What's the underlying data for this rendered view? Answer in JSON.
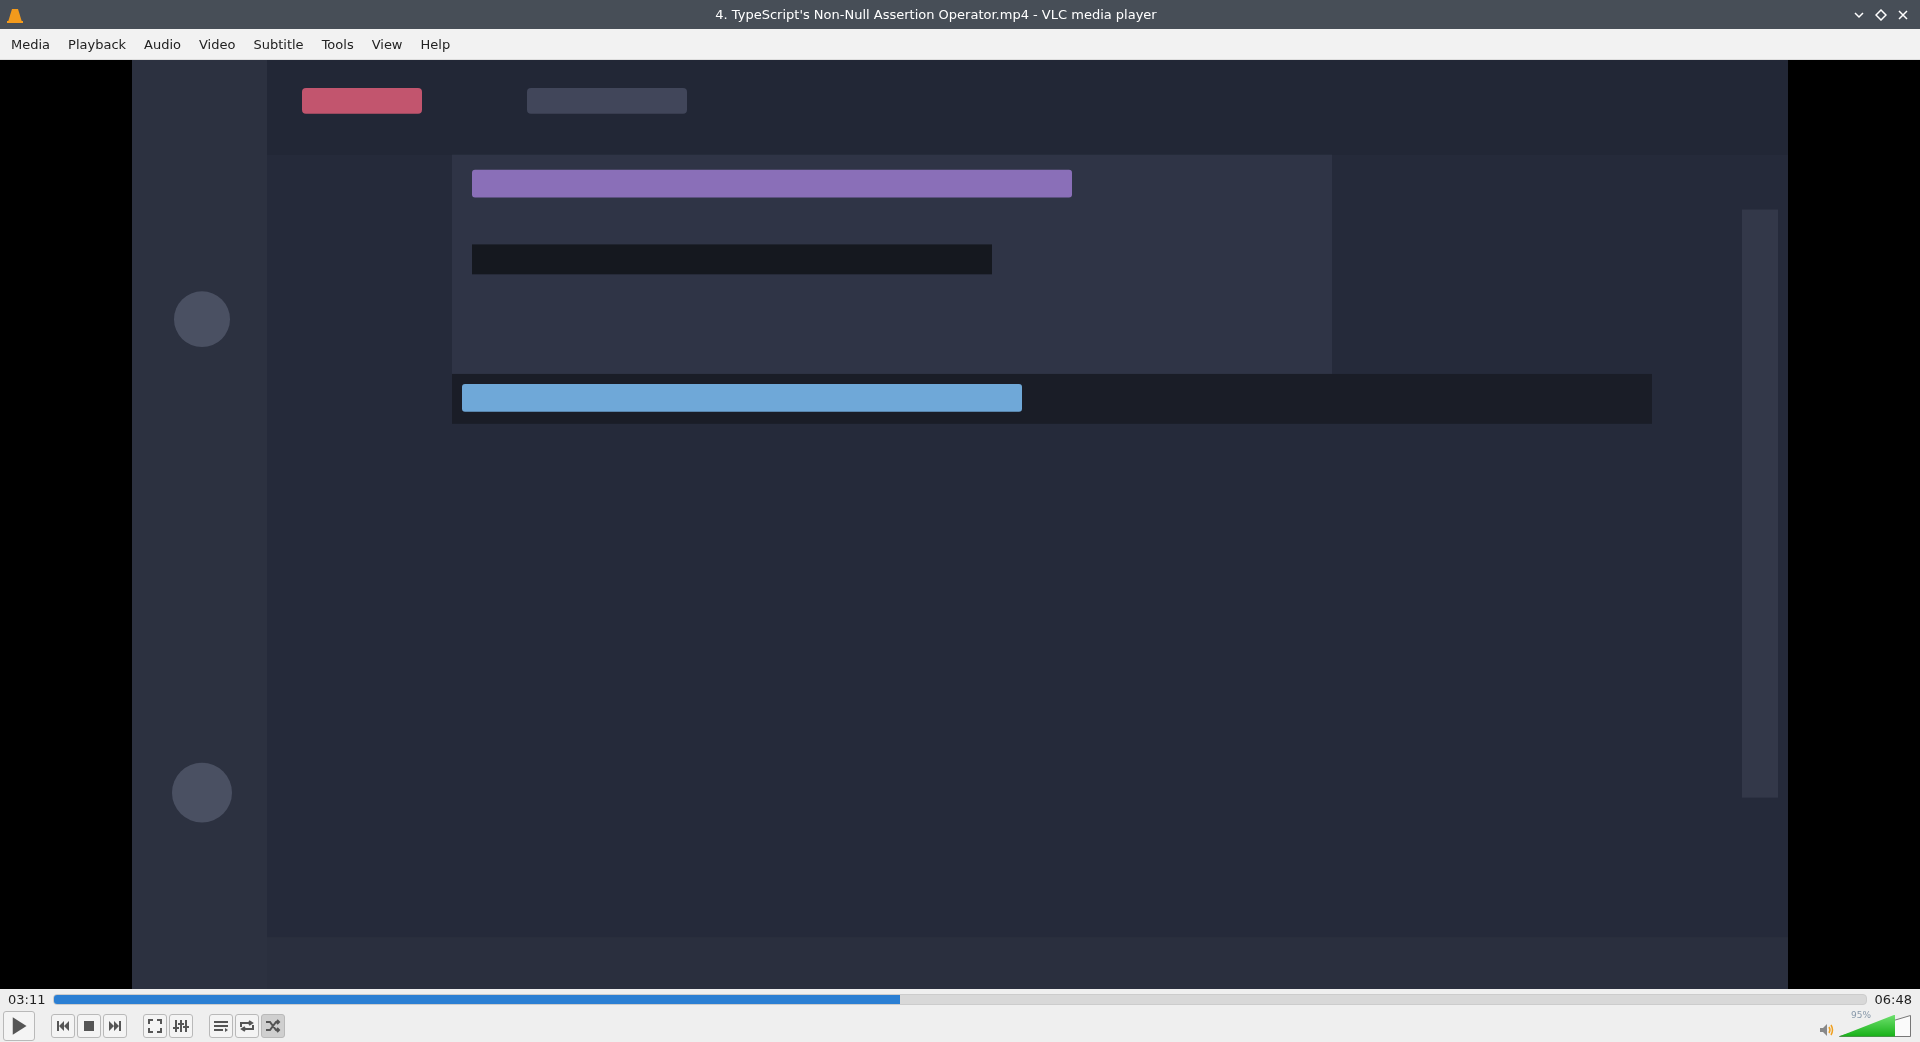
{
  "window": {
    "title": "4. TypeScript's Non-Null Assertion Operator.mp4 - VLC media player"
  },
  "menu": [
    "Media",
    "Playback",
    "Audio",
    "Video",
    "Subtitle",
    "Tools",
    "View",
    "Help"
  ],
  "video": {
    "kind": "picture"
  },
  "seek": {
    "elapsed": "03:11",
    "total": "06:48",
    "level": 0.467
  },
  "controls": [
    {
      "kind": "play",
      "on": false
    },
    {
      "kind": "prev",
      "on": false
    },
    {
      "kind": "stop",
      "on": false
    },
    {
      "kind": "next",
      "on": false
    },
    {
      "kind": "fullscreen",
      "on": false
    },
    {
      "kind": "extended",
      "on": false
    },
    {
      "kind": "playlist",
      "on": false
    },
    {
      "kind": "loop",
      "on": false
    },
    {
      "kind": "shuffle",
      "on": true
    }
  ],
  "volume": {
    "reading": "95%",
    "level": 0.78
  }
}
